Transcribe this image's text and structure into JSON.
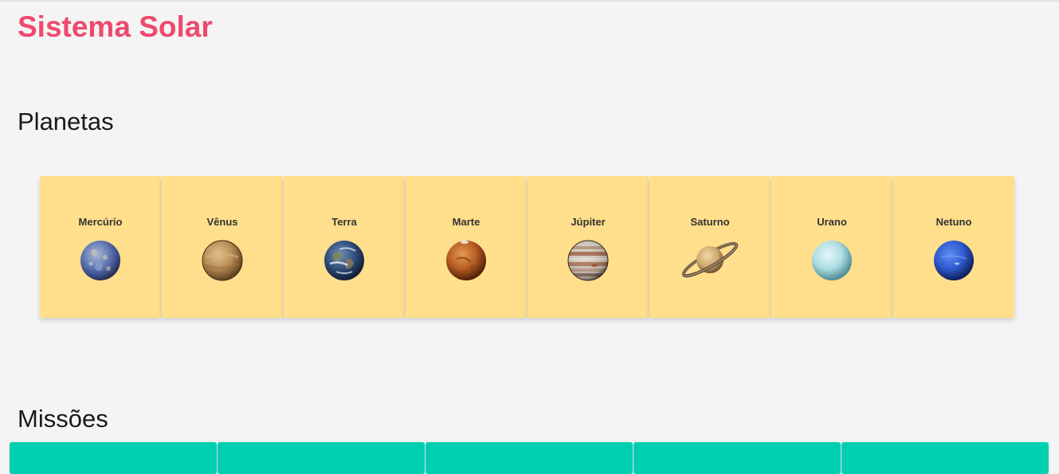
{
  "app": {
    "title": "Sistema Solar"
  },
  "sections": {
    "planets_title": "Planetas",
    "missions_title": "Missões"
  },
  "planets": [
    {
      "name": "Mercúrio",
      "icon": "mercury-icon"
    },
    {
      "name": "Vênus",
      "icon": "venus-icon"
    },
    {
      "name": "Terra",
      "icon": "earth-icon"
    },
    {
      "name": "Marte",
      "icon": "mars-icon"
    },
    {
      "name": "Júpiter",
      "icon": "jupiter-icon"
    },
    {
      "name": "Saturno",
      "icon": "saturn-icon"
    },
    {
      "name": "Urano",
      "icon": "uranus-icon"
    },
    {
      "name": "Netuno",
      "icon": "neptune-icon"
    }
  ],
  "colors": {
    "title": "#ee4a6d",
    "planet_card": "#ffdf8c",
    "mission_card": "#00d0b2",
    "background": "#f4f4f4"
  }
}
